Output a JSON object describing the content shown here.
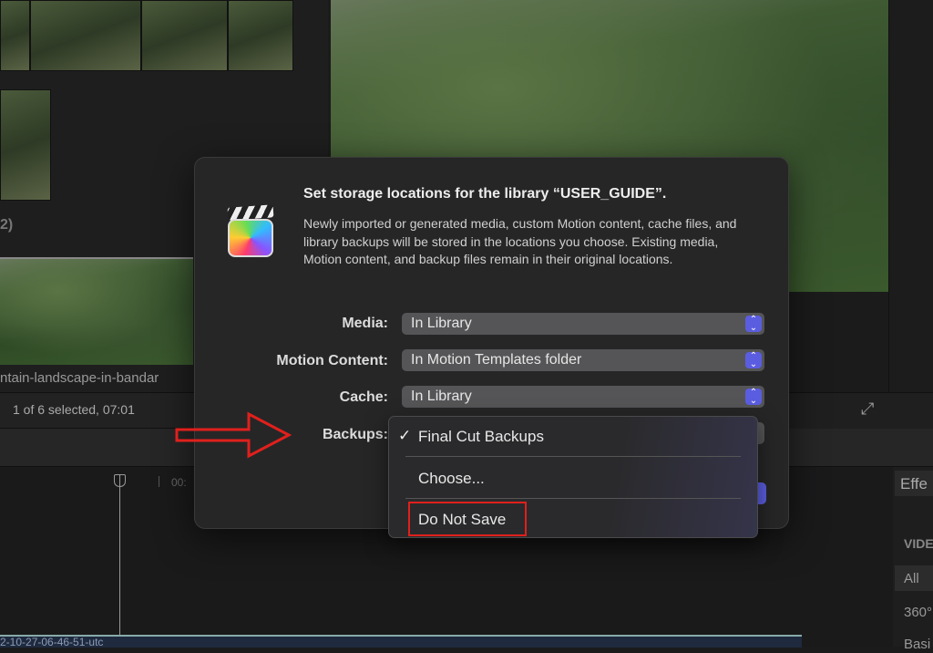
{
  "browser": {
    "group_label": "2)",
    "clip_name": "ntain-landscape-in-bandar",
    "status": "1 of 6 selected, 07:01"
  },
  "timeline": {
    "ruler_label": "00:",
    "clip_label": "2-10-27-06-46-51-utc"
  },
  "effects": {
    "title": "Effe",
    "section": "VIDE",
    "items": [
      "All",
      "360°",
      "Basi"
    ]
  },
  "dialog": {
    "title": "Set storage locations for the library “USER_GUIDE”.",
    "body": "Newly imported or generated media, custom Motion content, cache files, and library backups will be stored in the locations you choose. Existing media, Motion content, and backup files remain in their original locations.",
    "rows": [
      {
        "label": "Media:",
        "value": "In Library"
      },
      {
        "label": "Motion Content:",
        "value": "In Motion Templates folder"
      },
      {
        "label": "Cache:",
        "value": "In Library"
      },
      {
        "label": "Backups:",
        "value": "Final Cut Backups"
      }
    ]
  },
  "menu": {
    "items": [
      {
        "label": "Final Cut Backups",
        "checked": true,
        "check": "✓"
      },
      {
        "label": "Choose..."
      },
      {
        "label": "Do Not Save",
        "highlighted": true
      }
    ]
  },
  "colors": {
    "accent": "#5b5de0",
    "annotation": "#e0201c"
  }
}
